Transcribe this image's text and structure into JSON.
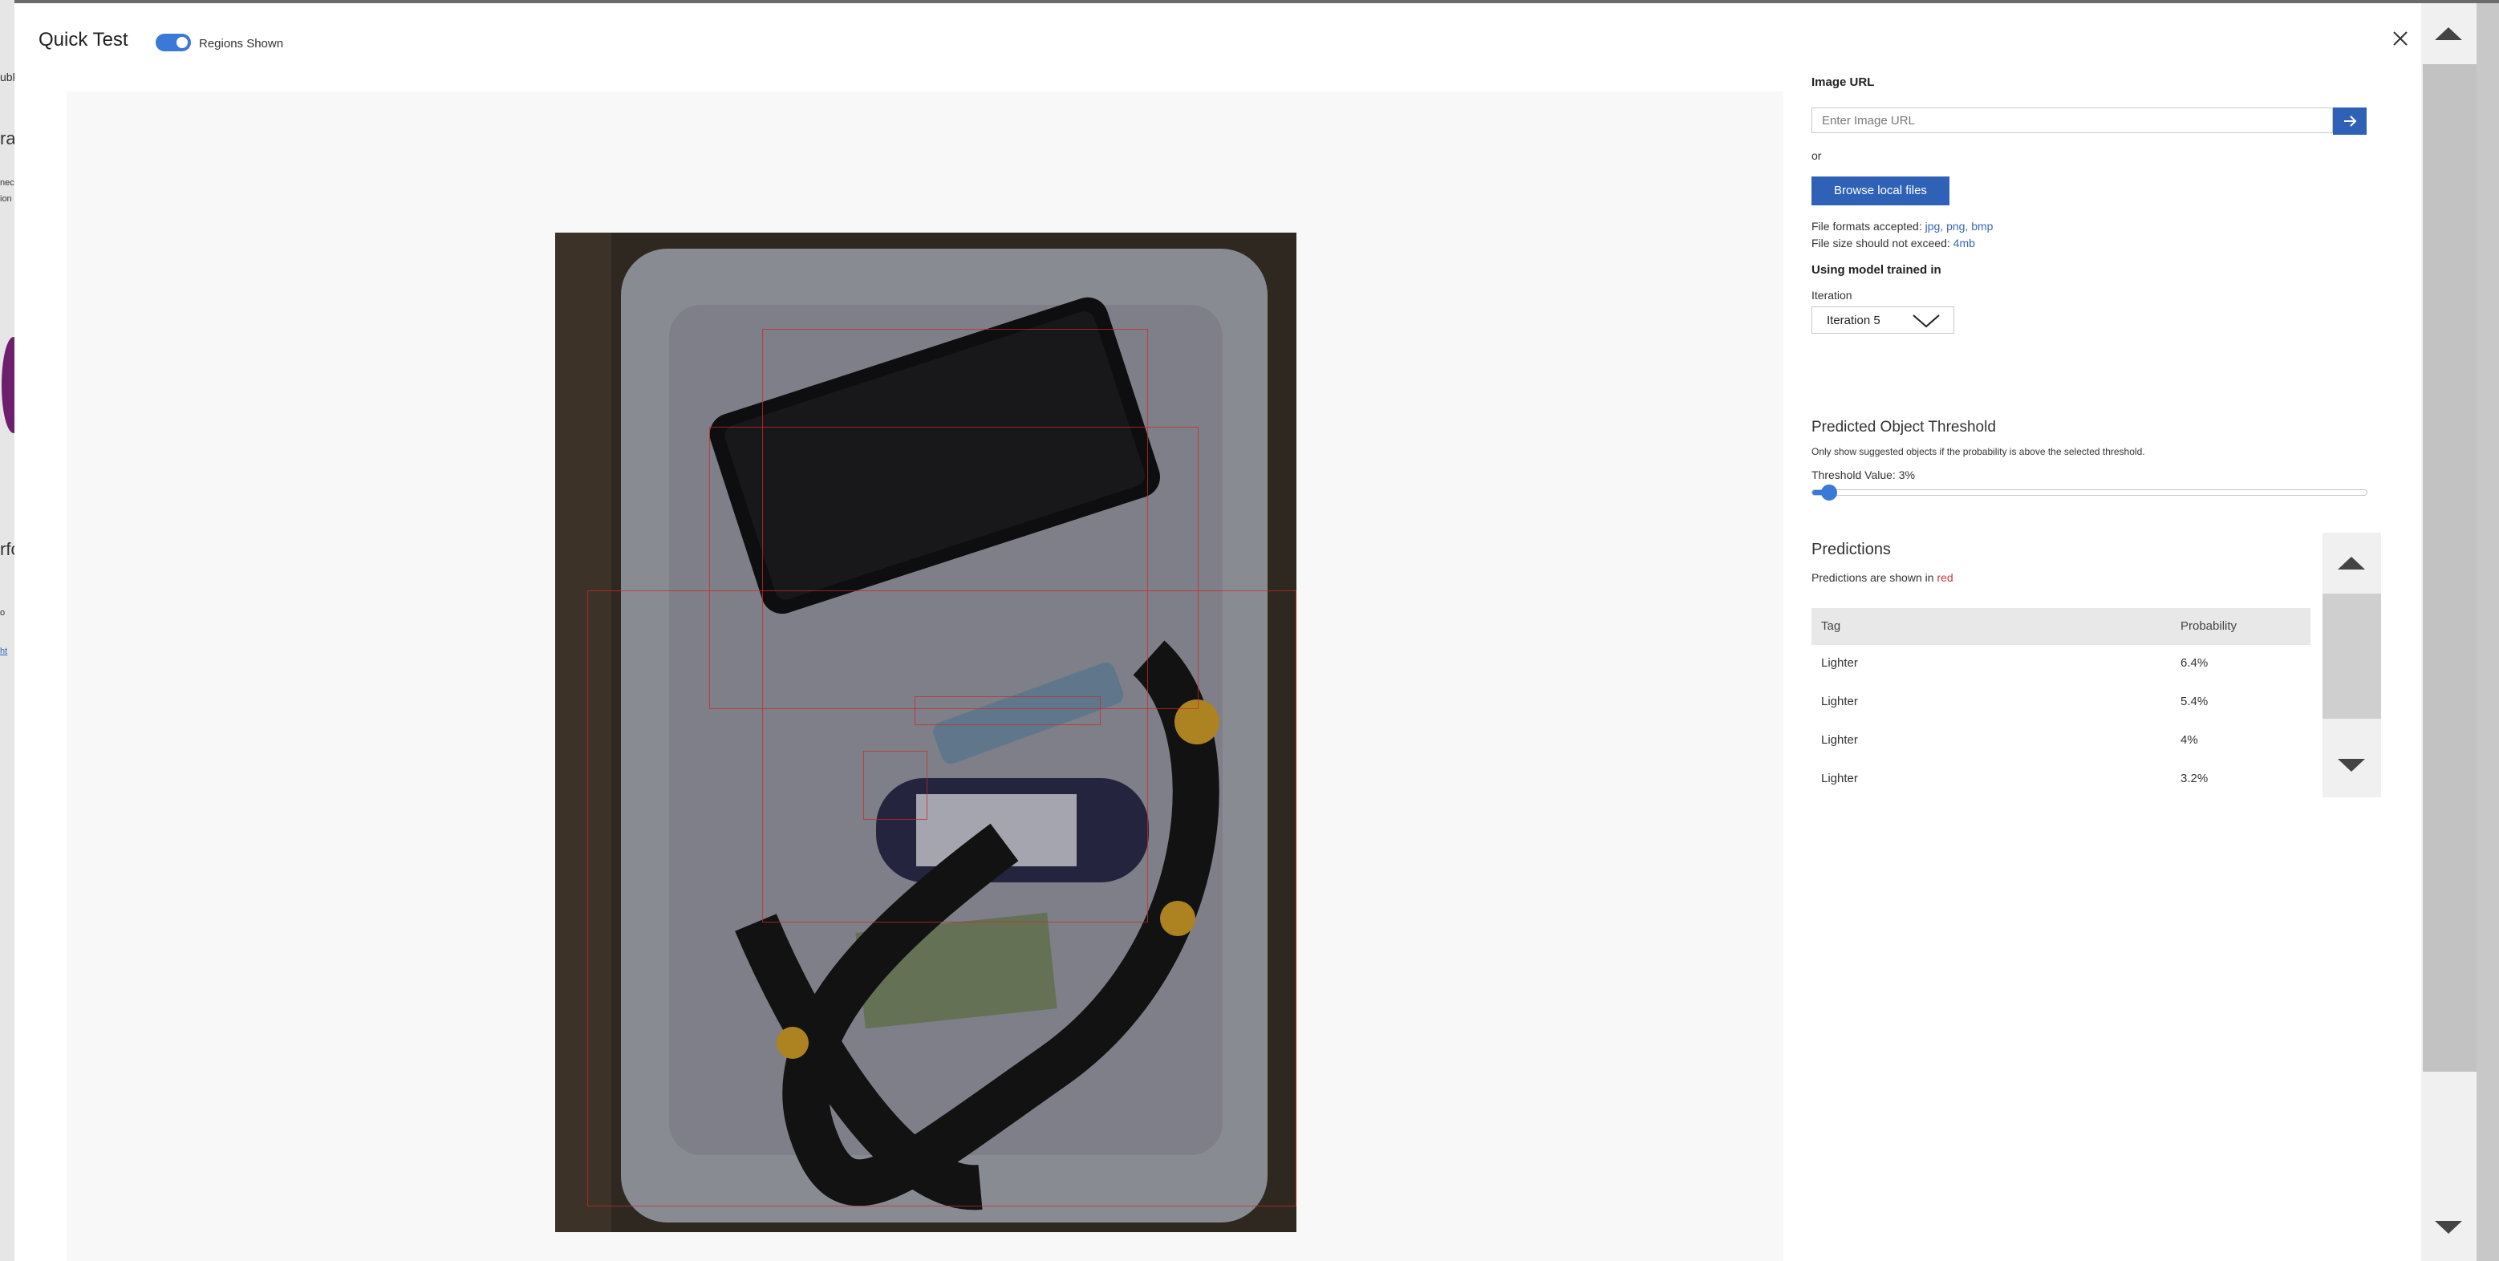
{
  "header": {
    "title": "Quick Test",
    "toggle_label": "Regions Shown",
    "toggle_on": true
  },
  "underlay_fragments": [
    "ubl",
    "ra",
    "nec",
    "ion",
    "rfo",
    "o",
    "ht"
  ],
  "image_panel": {
    "url_label": "Image URL",
    "url_placeholder": "Enter Image URL",
    "url_value": "",
    "or_text": "or",
    "browse_label": "Browse local files",
    "formats_prefix": "File formats accepted: ",
    "formats_value": "jpg, png, bmp",
    "size_prefix": "File size should not exceed: ",
    "size_value": "4mb"
  },
  "model": {
    "using_label": "Using model trained in",
    "iteration_label": "Iteration",
    "iteration_selected": "Iteration 5"
  },
  "threshold": {
    "title": "Predicted Object Threshold",
    "description": "Only show suggested objects if the probability is above the selected threshold.",
    "value_label": "Threshold Value: 3%",
    "value_percent": 3
  },
  "predictions": {
    "title": "Predictions",
    "subtitle_prefix": "Predictions are shown in ",
    "subtitle_color_word": "red",
    "columns": {
      "tag": "Tag",
      "probability": "Probability"
    },
    "rows": [
      {
        "tag": "Lighter",
        "probability": "6.4%"
      },
      {
        "tag": "Lighter",
        "probability": "5.4%"
      },
      {
        "tag": "Lighter",
        "probability": "4%"
      },
      {
        "tag": "Lighter",
        "probability": "3.2%"
      }
    ]
  },
  "colors": {
    "accent": "#2f62b7",
    "toggle": "#3b79d6",
    "region_border": "#cd2828",
    "prediction_word": "#d13438"
  },
  "icons": [
    "close-icon",
    "arrow-right-icon",
    "chevron-down-icon",
    "scroll-up-icon",
    "scroll-down-icon"
  ]
}
